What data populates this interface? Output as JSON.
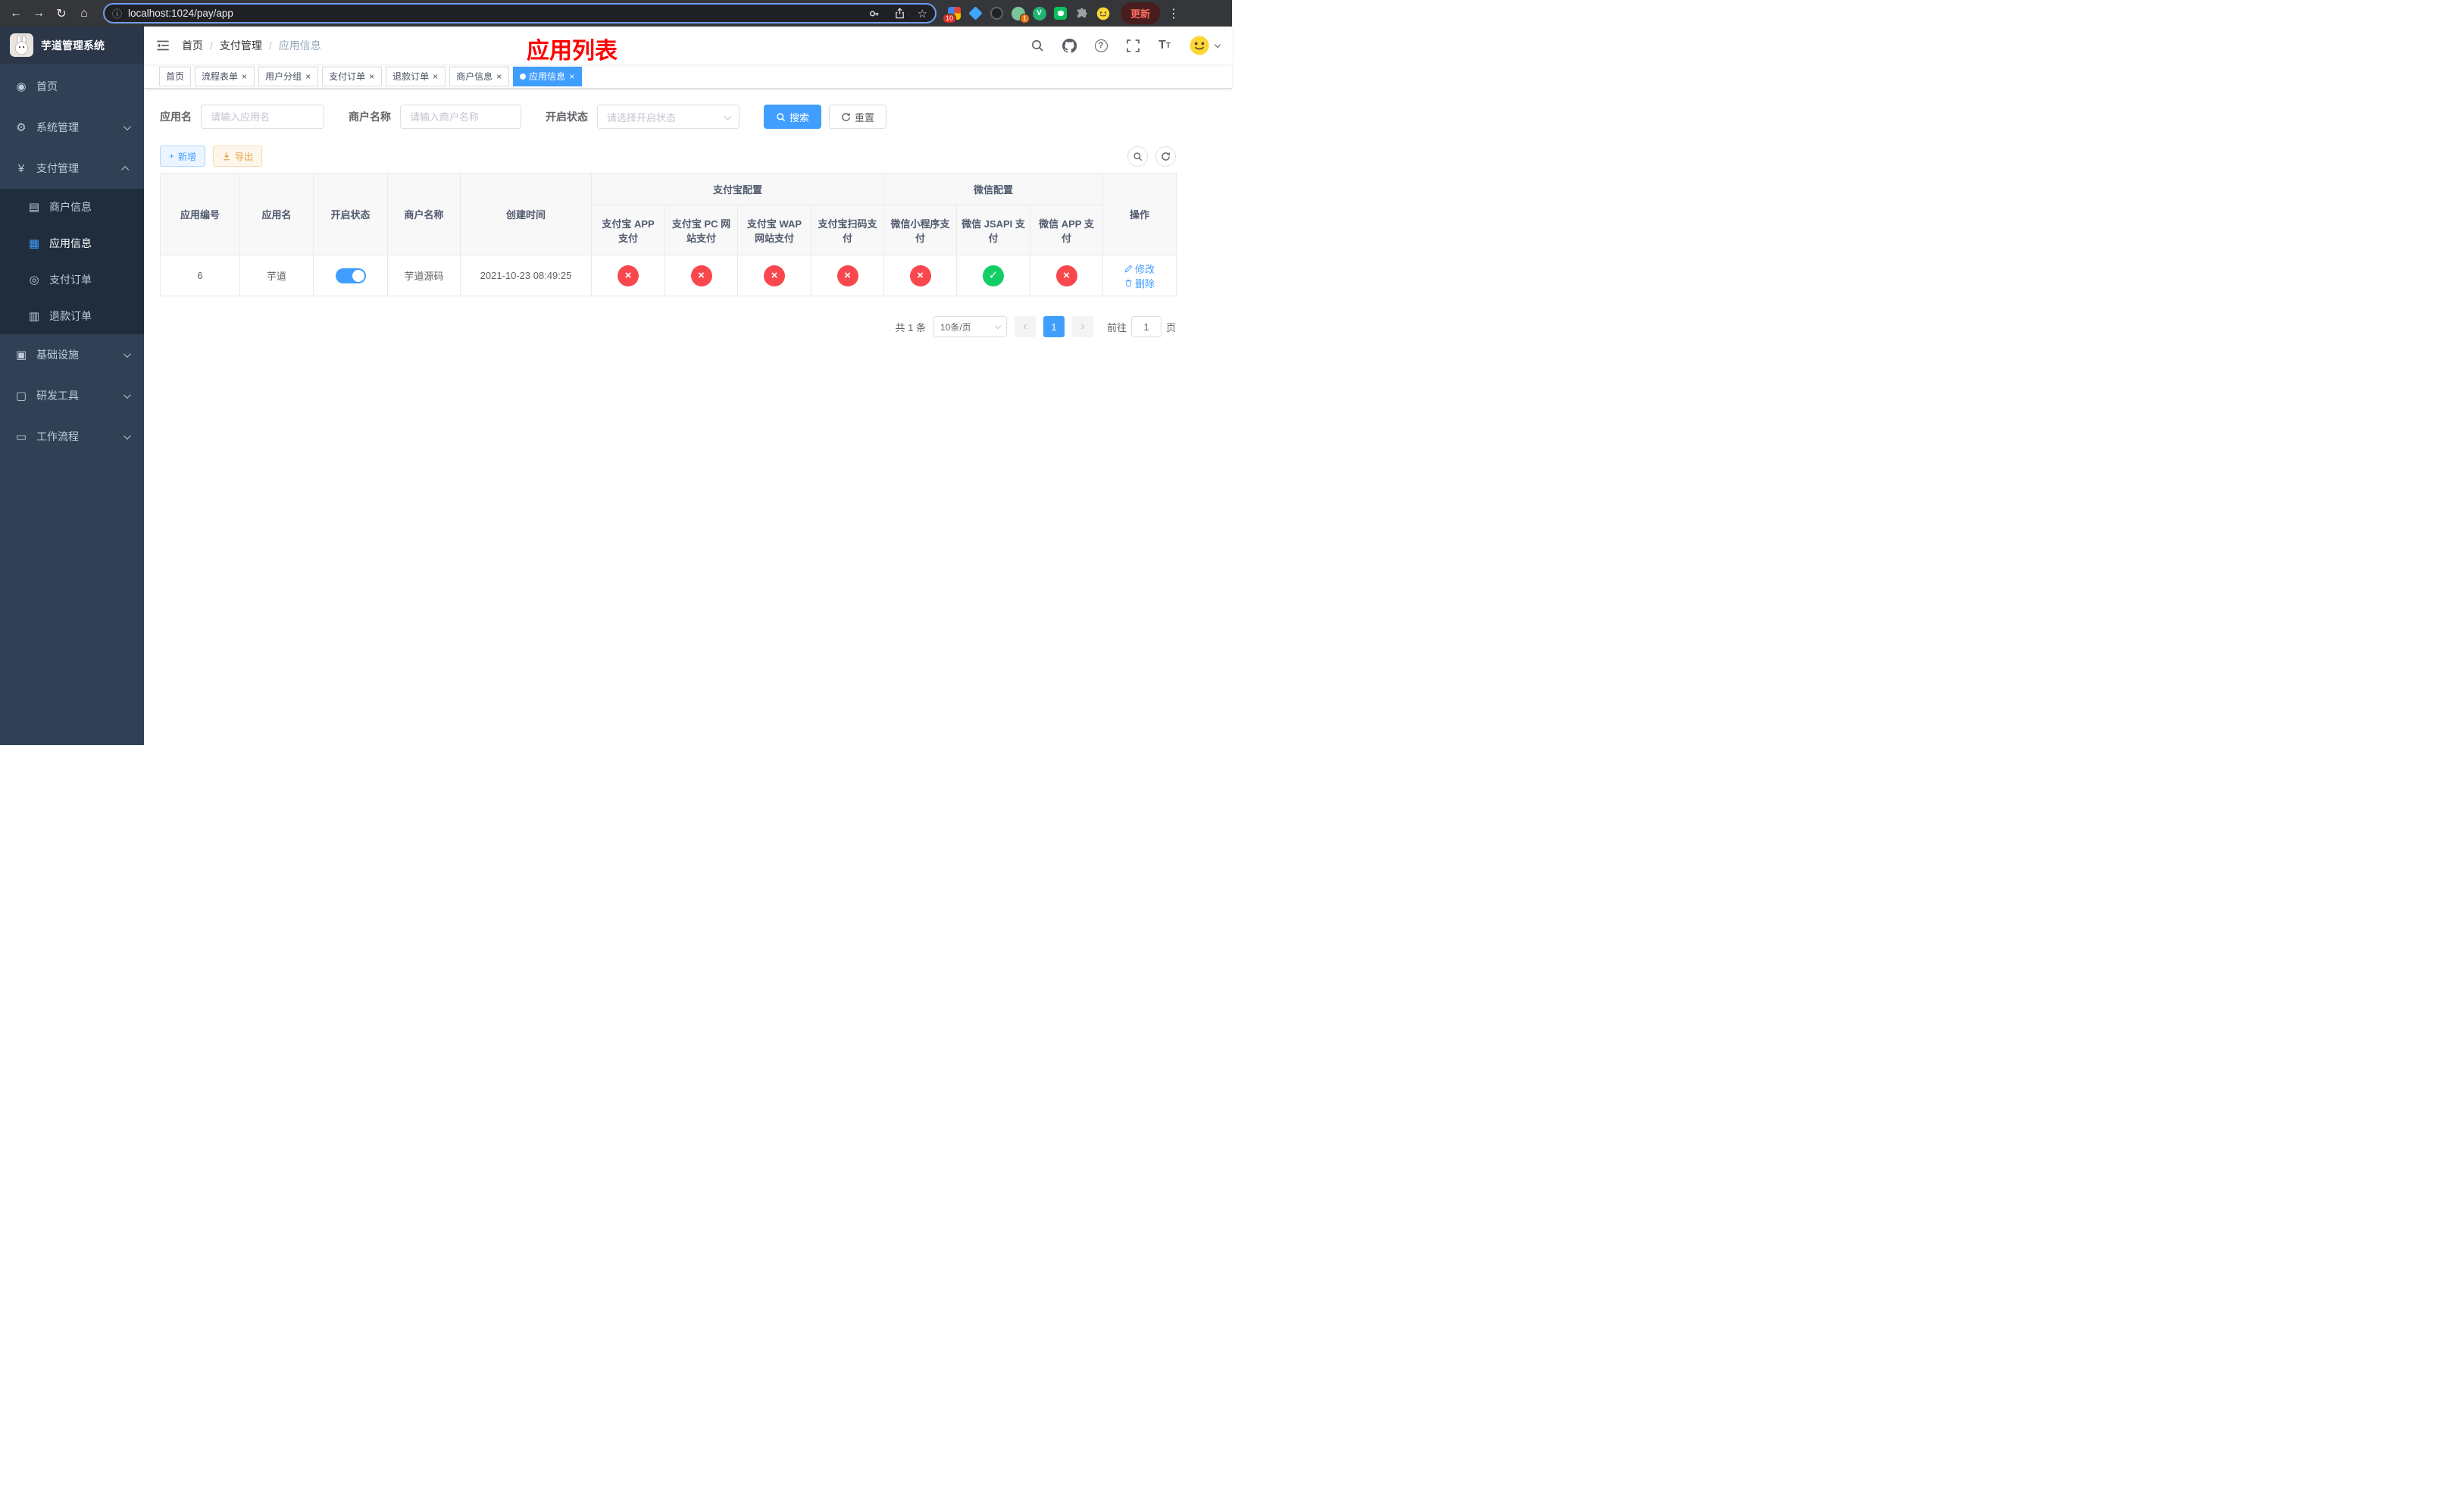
{
  "colors": {
    "accent": "#409eff",
    "success": "#13ce66",
    "danger": "#f8484e",
    "page_title_red": "#ff0000",
    "sidebar_bg": "#304156",
    "sidebar_submenu_bg": "#1f2d3d"
  },
  "browser": {
    "url": "localhost:1024/pay/app",
    "update_button": "更新",
    "extension_badge_1": "10",
    "extension_badge_2": "1"
  },
  "sidebar": {
    "title": "芋道管理系统",
    "items": [
      {
        "label": "首页",
        "icon": "dashboard-icon"
      },
      {
        "label": "系统管理",
        "icon": "gear-icon"
      },
      {
        "label": "支付管理",
        "icon": "yen-icon"
      },
      {
        "label": "基础设施",
        "icon": "infrastructure-icon"
      },
      {
        "label": "研发工具",
        "icon": "devtools-icon"
      },
      {
        "label": "工作流程",
        "icon": "workflow-icon"
      }
    ],
    "payment_children": [
      {
        "label": "商户信息",
        "icon": "merchant-icon"
      },
      {
        "label": "应用信息",
        "icon": "app-grid-icon"
      },
      {
        "label": "支付订单",
        "icon": "order-icon"
      },
      {
        "label": "退款订单",
        "icon": "refund-icon"
      }
    ]
  },
  "header": {
    "breadcrumb": {
      "home": "首页",
      "section": "支付管理",
      "current": "应用信息"
    },
    "page_title": "应用列表"
  },
  "tabs": [
    {
      "label": "首页"
    },
    {
      "label": "流程表单"
    },
    {
      "label": "用户分组"
    },
    {
      "label": "支付订单"
    },
    {
      "label": "退款订单"
    },
    {
      "label": "商户信息"
    },
    {
      "label": "应用信息"
    }
  ],
  "filters": {
    "app_name_label": "应用名",
    "app_name_placeholder": "请输入应用名",
    "merchant_label": "商户名称",
    "merchant_placeholder": "请输入商户名称",
    "status_label": "开启状态",
    "status_placeholder": "请选择开启状态",
    "search_button": "搜索",
    "reset_button": "重置"
  },
  "toolbar": {
    "add_button": "新增",
    "export_button": "导出"
  },
  "table": {
    "columns": {
      "app_id": "应用编号",
      "app_name": "应用名",
      "status": "开启状态",
      "merchant": "商户名称",
      "created": "创建时间",
      "alipay_group": "支付宝配置",
      "alipay_app": "支付宝 APP 支付",
      "alipay_pc": "支付宝 PC 网站支付",
      "alipay_wap": "支付宝 WAP 网站支付",
      "alipay_qr": "支付宝扫码支付",
      "wechat_group": "微信配置",
      "wechat_mini": "微信小程序支付",
      "wechat_jsapi": "微信 JSAPI 支付",
      "wechat_app": "微信 APP 支付",
      "actions": "操作"
    },
    "rows": [
      {
        "app_id": "6",
        "app_name": "芋道",
        "status_on": true,
        "merchant": "芋道源码",
        "created": "2021-10-23 08:49:25",
        "alipay_app": false,
        "alipay_pc": false,
        "alipay_wap": false,
        "alipay_qr": false,
        "wechat_mini": false,
        "wechat_jsapi": true,
        "wechat_app": false,
        "edit_label": "修改",
        "delete_label": "删除"
      }
    ]
  },
  "pagination": {
    "total": "共 1 条",
    "page_size": "10条/页",
    "current_page": "1",
    "goto_label": "前往",
    "goto_value": "1",
    "goto_suffix": "页"
  }
}
